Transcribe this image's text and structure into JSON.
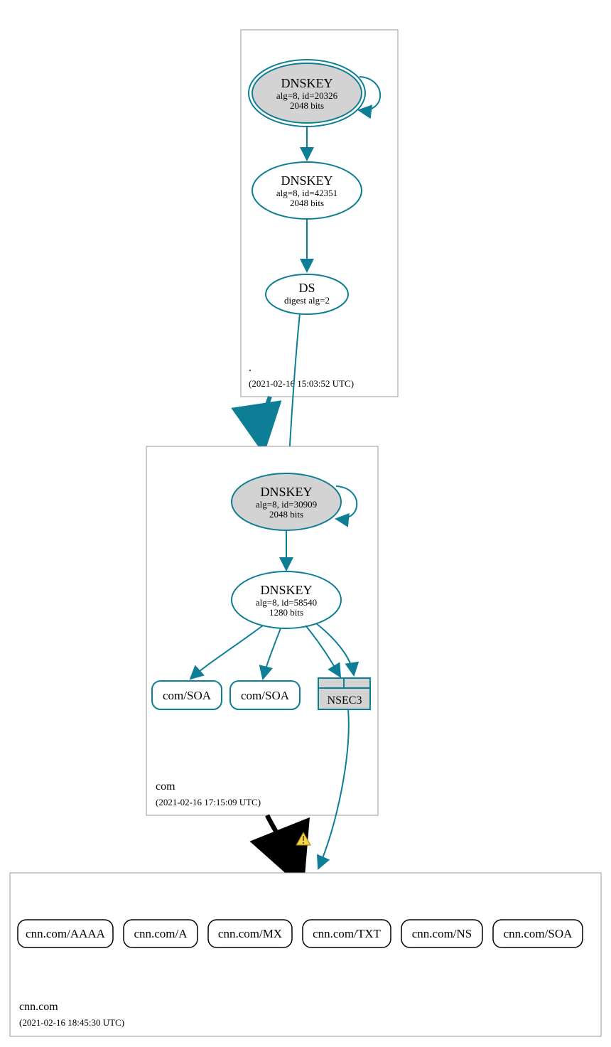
{
  "colors": {
    "teal": "#0e7e96",
    "gray": "#d3d3d3",
    "black": "#000000"
  },
  "zones": {
    "root": {
      "name": ".",
      "timestamp": "(2021-02-16 15:03:52 UTC)"
    },
    "com": {
      "name": "com",
      "timestamp": "(2021-02-16 17:15:09 UTC)"
    },
    "cnn": {
      "name": "cnn.com",
      "timestamp": "(2021-02-16 18:45:30 UTC)"
    }
  },
  "nodes": {
    "root_ksk": {
      "title": "DNSKEY",
      "sub1": "alg=8, id=20326",
      "sub2": "2048 bits"
    },
    "root_zsk": {
      "title": "DNSKEY",
      "sub1": "alg=8, id=42351",
      "sub2": "2048 bits"
    },
    "root_ds": {
      "title": "DS",
      "sub1": "digest alg=2"
    },
    "com_ksk": {
      "title": "DNSKEY",
      "sub1": "alg=8, id=30909",
      "sub2": "2048 bits"
    },
    "com_zsk": {
      "title": "DNSKEY",
      "sub1": "alg=8, id=58540",
      "sub2": "1280 bits"
    },
    "com_soa1": {
      "label": "com/SOA"
    },
    "com_soa2": {
      "label": "com/SOA"
    },
    "com_nsec3": {
      "label": "NSEC3"
    }
  },
  "cnn_records": [
    {
      "label": "cnn.com/AAAA"
    },
    {
      "label": "cnn.com/A"
    },
    {
      "label": "cnn.com/MX"
    },
    {
      "label": "cnn.com/TXT"
    },
    {
      "label": "cnn.com/NS"
    },
    {
      "label": "cnn.com/SOA"
    }
  ]
}
